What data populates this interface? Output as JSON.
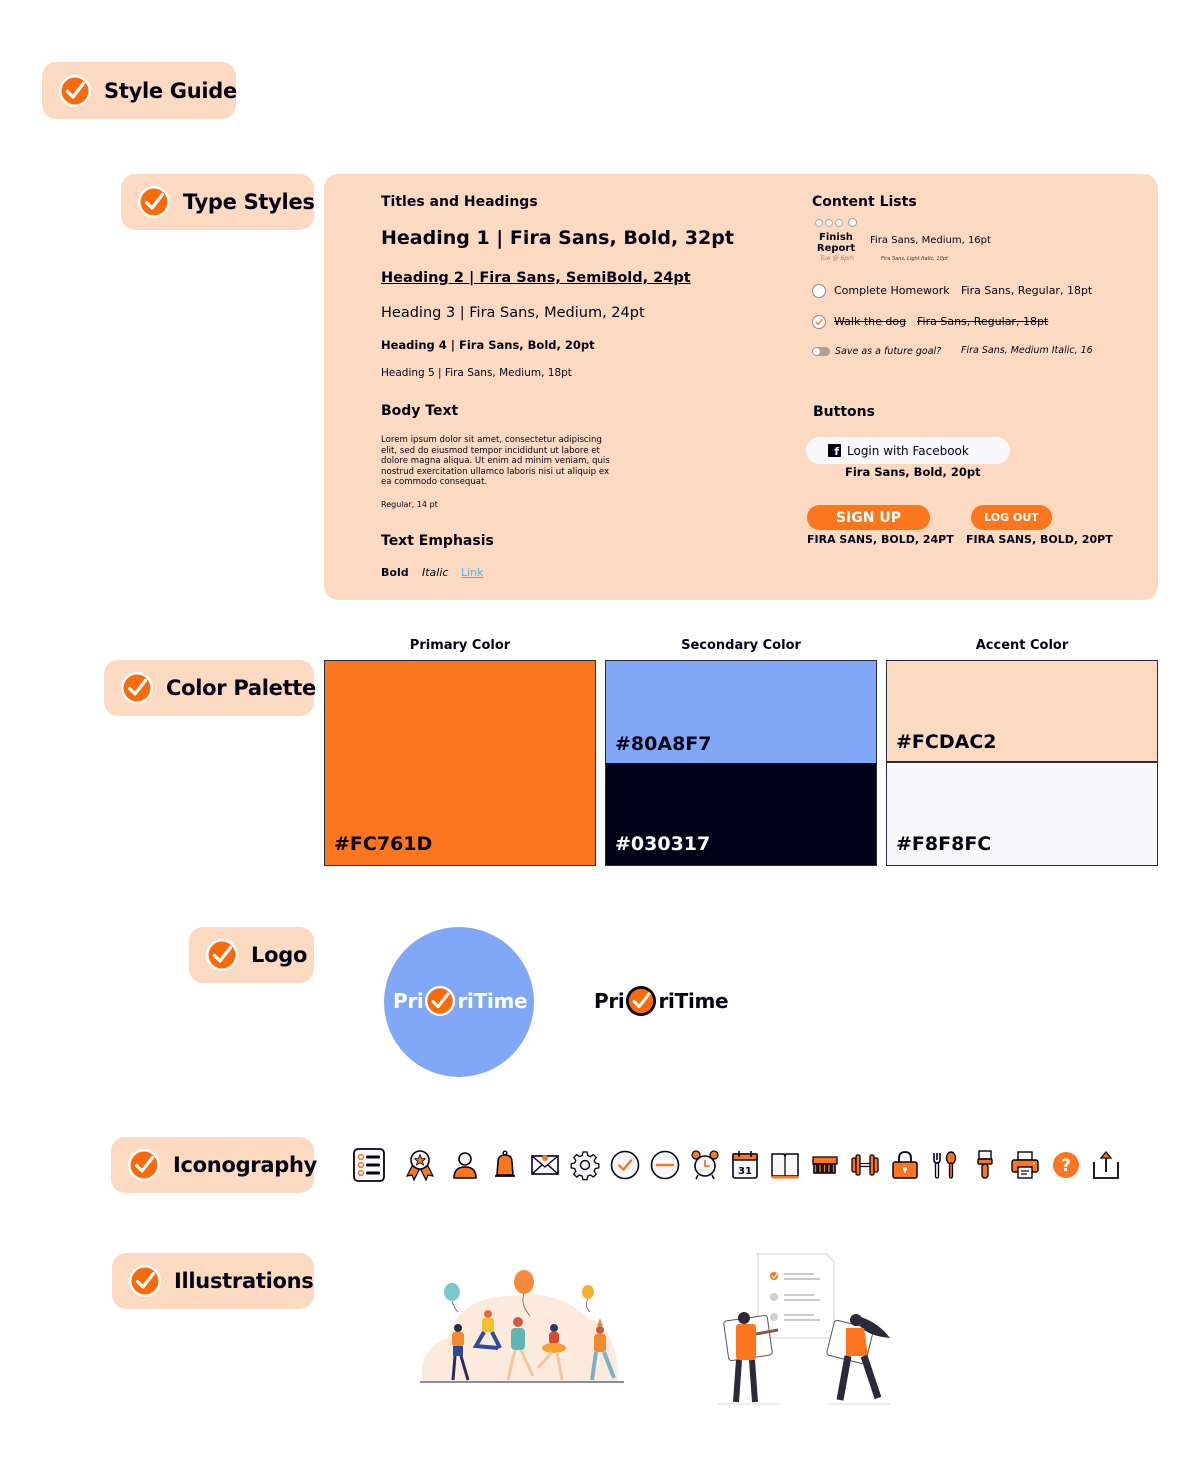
{
  "sections": {
    "style_guide": "Style Guide",
    "type_styles": "Type Styles",
    "color_palette": "Color Palette",
    "logo": "Logo",
    "iconography": "Iconography",
    "illustrations": "Illustrations"
  },
  "type_styles": {
    "titles_heading": "Titles and Headings",
    "h1": "Heading 1 | Fira Sans, Bold, 32pt",
    "h2": "Heading 2 | Fira Sans, SemiBold, 24pt",
    "h3": "Heading 3 | Fira Sans, Medium, 24pt",
    "h4": "Heading 4 | Fira Sans, Bold, 20pt",
    "h5": "Heading 5 | Fira Sans, Medium, 18pt",
    "body_heading": "Body Text",
    "body_text": "Lorem ipsum dolor sit amet, consectetur adipiscing elit, sed do eiusmod tempor incididunt ut labore et dolore magna aliqua. Ut enim ad minim veniam, quis nostrud exercitation ullamco laboris nisi ut aliquip ex ea commodo consequat.",
    "body_note": "Regular, 14 pt",
    "emphasis_heading": "Text Emphasis",
    "emphasis_bold": "Bold",
    "emphasis_italic": "Italic",
    "emphasis_link": "Link",
    "content_lists": {
      "heading": "Content Lists",
      "task_title": "Finish Report",
      "task_title_line1": "Finish",
      "task_title_line2": "Report",
      "task_due": "Tue @ 6pm",
      "task_title_note": "Fira Sans, Medium, 16pt",
      "task_due_note": "Fira Sans, Light Italic, 10pt",
      "items": [
        {
          "label": "Complete Homework",
          "note": "Fira Sans, Regular, 18pt",
          "checked": false
        },
        {
          "label": "Walk the dog",
          "note": "Fira Sans, Regular, 18pt",
          "checked": true
        }
      ],
      "toggle_label": "Save as a future goal?",
      "toggle_note": "Fira Sans, Medium Italic, 16",
      "toggle_on": false
    },
    "buttons": {
      "heading": "Buttons",
      "facebook_label": "Login with Facebook",
      "facebook_note": "Fira Sans, Bold, 20pt",
      "signup_label": "SIGN UP",
      "signup_note": "FIRA SANS, BOLD, 24PT",
      "logout_label": "LOG OUT",
      "logout_note": "FIRA SANS, BOLD, 20PT"
    }
  },
  "palette": {
    "primary": {
      "title": "Primary Color",
      "colors": [
        "#FC761D"
      ]
    },
    "secondary": {
      "title": "Secondary Color",
      "colors": [
        "#80A8F7",
        "#030317"
      ]
    },
    "accent": {
      "title": "Accent Color",
      "colors": [
        "#FCDAC2",
        "#F8F8FC"
      ]
    }
  },
  "logo": {
    "part1": "Pri",
    "part2": "riTime"
  },
  "icons": [
    "checklist-icon",
    "award-ribbon-icon",
    "user-icon",
    "bell-icon",
    "mail-icon",
    "gear-icon",
    "check-circle-icon",
    "minus-circle-icon",
    "alarm-clock-icon",
    "calendar-icon",
    "book-icon",
    "comb-icon",
    "dumbbell-icon",
    "lock-icon",
    "fork-spoon-icon",
    "paintbrush-icon",
    "printer-icon",
    "help-icon",
    "share-icon"
  ],
  "calendar_day": "31",
  "colors": {
    "primary": "#FC761D",
    "secondary": "#80A8F7",
    "dark": "#030317",
    "accent": "#FCDAC2",
    "light": "#F8F8FC",
    "link": "#4AB6E8"
  }
}
